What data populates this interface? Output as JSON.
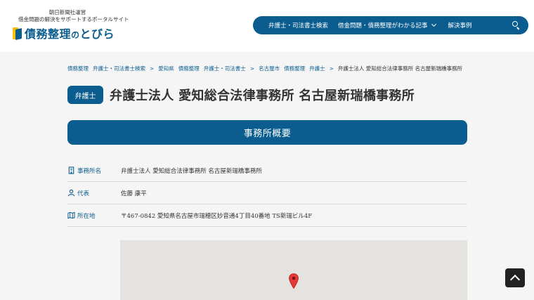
{
  "header": {
    "operator_line": "朝日新聞社運営",
    "tagline": "借金問題の解決をサポートするポータルサイト",
    "logo_main": "債務整理",
    "logo_particle": "の",
    "logo_tail": "とびら"
  },
  "nav": {
    "items": [
      {
        "label": "弁護士・司法書士検索"
      },
      {
        "label": "借金問題・債務整理がわかる記事"
      },
      {
        "label": "解決事例"
      }
    ],
    "search_icon": "search-icon"
  },
  "breadcrumb": [
    "債務整理",
    "弁護士・司法書士検索",
    "愛知県",
    "債務整理",
    "弁護士・司法書士",
    "名古屋市",
    "債務整理",
    "弁護士",
    "弁護士法人 愛知総合法律事務所 名古屋新瑞橋事務所"
  ],
  "office": {
    "badge": "弁護士",
    "title": "弁護士法人 愛知総合法律事務所 名古屋新瑞橋事務所"
  },
  "overview": {
    "heading": "事務所概要",
    "rows": [
      {
        "icon": "building-icon",
        "label": "事務所名",
        "value": "弁護士法人 愛知総合法律事務所 名古屋新瑞橋事務所"
      },
      {
        "icon": "person-icon",
        "label": "代表",
        "value": "佐藤 康平"
      },
      {
        "icon": "map-icon",
        "label": "所在地",
        "value": "〒467-0842 愛知県名古屋市瑞穂区妙音通4丁目40番地 TS新瑞ビル4F"
      }
    ]
  },
  "colors": {
    "brand": "#0b5d8f",
    "accent_yellow": "#f4c20d",
    "pin": "#e53935"
  }
}
